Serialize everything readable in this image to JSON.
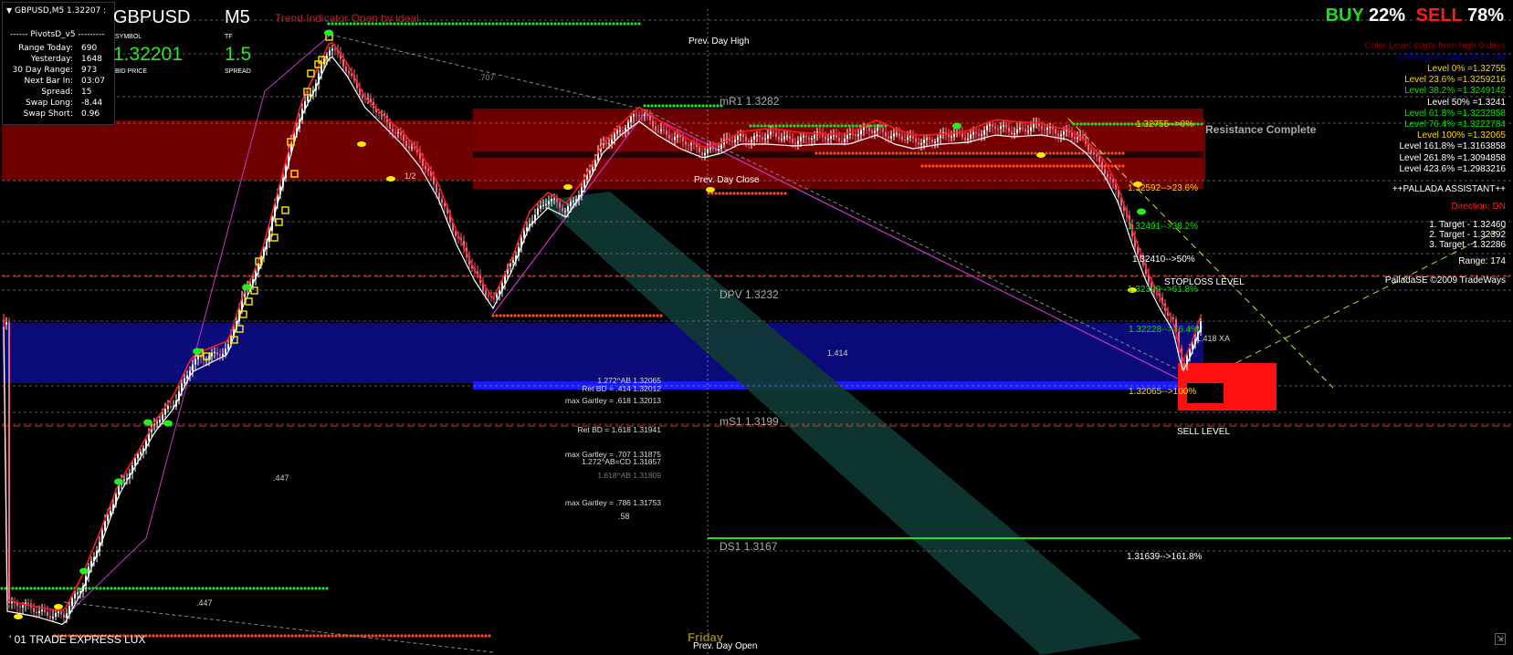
{
  "window": {
    "title": "GBPUSD,M5  1.32207 :"
  },
  "pivots": {
    "title": "------  PivotsD_v5  ---------",
    "rows": [
      {
        "label": "Range  Today:",
        "value": "690"
      },
      {
        "label": "Yesterday:",
        "value": "1648"
      },
      {
        "label": "30 Day Range:",
        "value": "973"
      },
      {
        "label": "Next Bar In:",
        "value": "03:07"
      },
      {
        "label": "Spread:",
        "value": "15"
      },
      {
        "label": "Swap  Long:",
        "value": "-8.44"
      },
      {
        "label": "Swap  Short:",
        "value": "0.96"
      }
    ]
  },
  "symbol_panel": {
    "symbol": "GBPUSD",
    "symbol_label": "SYMBOL",
    "tf": "M5",
    "tf_label": "TF",
    "bid": "1.32201",
    "bid_label": "BID PRICE",
    "spread": "1.5",
    "spread_label": "SPREAD"
  },
  "trend_indicator": "Trend Indicator Open by ideal",
  "buy_sell": {
    "buy_label": "BUY",
    "buy_pct": "22%",
    "sell_label": "SELL",
    "sell_pct": "78%"
  },
  "fib_levels": {
    "header": "Color Level starts from high 0 days",
    "subheader": "Color Level starts from low",
    "levels": [
      {
        "text": "Level 0% =1.32755",
        "color": "#ffd700"
      },
      {
        "text": "Level 23.6% =1.3259216",
        "color": "#ffd700"
      },
      {
        "text": "Level 38.2% =1.3249142",
        "color": "#00e600"
      },
      {
        "text": "Level 50% =1.3241",
        "color": "#ffffff"
      },
      {
        "text": "Level 61.8% =1.3232858",
        "color": "#00e600"
      },
      {
        "text": "Level 76.4% =1.3222784",
        "color": "#00e600"
      },
      {
        "text": "Level 100% =1.32065",
        "color": "#ffd700"
      },
      {
        "text": "Level 161.8% =1.3163858",
        "color": "#ffffff"
      },
      {
        "text": "Level 261.8% =1.3094858",
        "color": "#ffffff"
      },
      {
        "text": "Level 423.6% =1.2983216",
        "color": "#ffffff"
      }
    ]
  },
  "assistant": {
    "title": "++PALLADA ASSISTANT++",
    "direction": "Direction: DN",
    "targets": [
      "1. Target - 1.32460",
      "2. Target - 1.32392",
      "3. Target - 1.32286"
    ],
    "range": "Range: 174",
    "copyright": "PalladaSE ©2009 TradeWays"
  },
  "levels": {
    "prev_day_high": "Prev. Day High",
    "prev_day_close": "Prev. Day Close",
    "prev_day_open": "Prev. Day Open",
    "mr1": "mR1   1.3282",
    "dpv": "DPV   1.3232",
    "ms1": "mS1   1.3199",
    "ds1": "DS1   1.3167",
    "resistance": "Resistance Complete",
    "stoploss": "STOPLOSS LEVEL",
    "sell_level": "SELL LEVEL",
    "friday": "Friday",
    "express": "' 01 TRADE EXPRESS LUX"
  },
  "fib_tags": [
    {
      "text": "1.32755-->0%",
      "color": "#ffd700"
    },
    {
      "text": "1.32592-->23.6%",
      "color": "#ffd700"
    },
    {
      "text": "1.32491-->38.2%",
      "color": "#00e600"
    },
    {
      "text": "1.32410-->50%",
      "color": "#ffffff"
    },
    {
      "text": "1.32329-->61.8%",
      "color": "#00e600"
    },
    {
      "text": "1.32228-->76.4%",
      "color": "#00e600"
    },
    {
      "text": "1.32065-->100%",
      "color": "#ffd700"
    },
    {
      "text": "1.31639-->161.8%",
      "color": "#ffffff"
    }
  ],
  "gartley": [
    "1.272^AB  1.32065",
    "Ret BD = .414  1.32012",
    "max Gartley = .618  1.32013",
    "Ret BD = 1.618  1.31941",
    "max Gartley = .707  1.31875",
    "1.272^AB=CD  1.31857",
    "1.618^AB  1.31809",
    "max Gartley = .786  1.31753"
  ],
  "ratios": {
    "r1": ".707",
    "r2": "1.414",
    "r3": ".447",
    "r4": ".447",
    "r5": ".58",
    "r6": "1.418 XA",
    "r7": "1/2"
  },
  "colors": {
    "resistance_zone": "#6e0000",
    "support_zone": "#0a0a78",
    "grid": "#9a9a9a",
    "channel": "#0f3a34",
    "bull": "#ffffff",
    "bear": "#e36a8c",
    "ma_red": "#ff1a1a"
  }
}
